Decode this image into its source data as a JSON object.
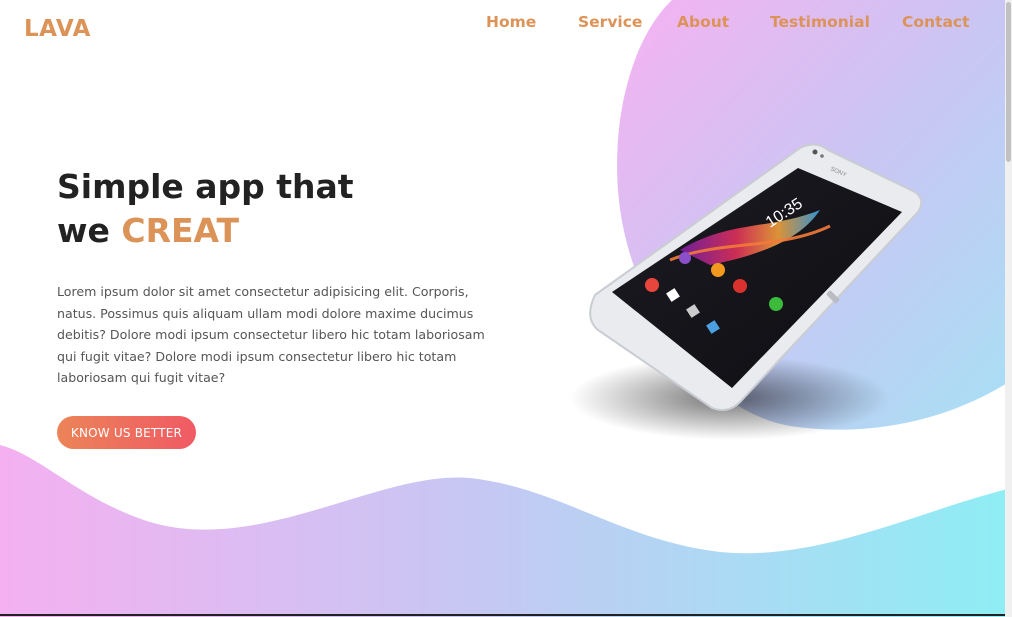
{
  "brand": {
    "logo": "LAVA",
    "accent_color": "#dc9358"
  },
  "nav": {
    "items": [
      {
        "label": "Home"
      },
      {
        "label": "Service"
      },
      {
        "label": "About"
      },
      {
        "label": "Testimonial"
      },
      {
        "label": "Contact"
      }
    ]
  },
  "hero": {
    "title_line1": "Simple app that",
    "title_we": "we ",
    "title_accent": "CREAT",
    "description": "Lorem ipsum dolor sit amet consectetur adipisicing elit. Corporis, natus. Possimus quis aliquam ullam modi dolore maxime ducimus debitis? Dolore modi ipsum consectetur libero hic totam laboriosam qui fugit vitae? Dolore modi ipsum consectetur libero hic totam laboriosam qui fugit vitae?",
    "cta_label": "KNOW US BETTER"
  },
  "phone": {
    "brand_text": "SONY",
    "clock": "10:35"
  },
  "colors": {
    "gradient_pink": "#f4b3f2",
    "gradient_blue": "#b6d5f4",
    "gradient_cyan": "#90eef5",
    "cta_start": "#eb8458",
    "cta_end": "#f05a64"
  }
}
